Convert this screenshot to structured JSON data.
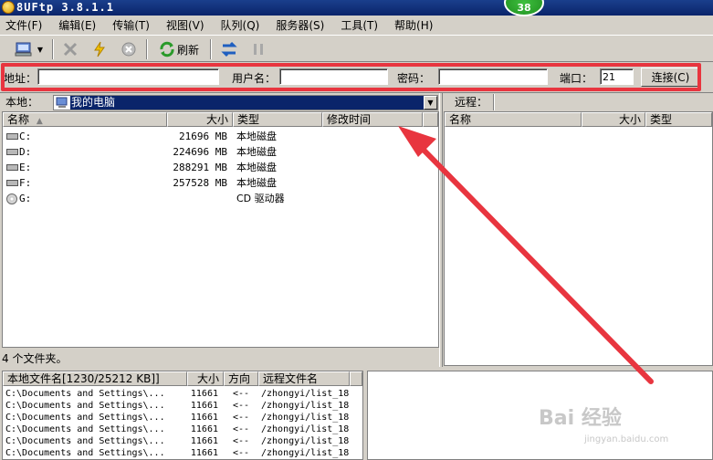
{
  "window": {
    "title": "8UFtp 3.8.1.1",
    "badge": "38"
  },
  "menu": [
    "文件(F)",
    "编辑(E)",
    "传输(T)",
    "视图(V)",
    "队列(Q)",
    "服务器(S)",
    "工具(T)",
    "帮助(H)"
  ],
  "toolbar": {
    "refresh_label": "刷新"
  },
  "connection": {
    "address_label": "地址：",
    "address_value": "",
    "username_label": "用户名：",
    "username_value": "",
    "password_label": "密码：",
    "password_value": "",
    "port_label": "端口：",
    "port_value": "21",
    "connect_label": "连接(C)"
  },
  "local": {
    "label": "本地：",
    "path": "我的电脑",
    "columns": [
      "名称",
      "大小",
      "类型",
      "修改时间"
    ],
    "rows": [
      {
        "name": "C:",
        "size": "21696 MB",
        "type": "本地磁盘"
      },
      {
        "name": "D:",
        "size": "224696 MB",
        "type": "本地磁盘"
      },
      {
        "name": "E:",
        "size": "288291 MB",
        "type": "本地磁盘"
      },
      {
        "name": "F:",
        "size": "257528 MB",
        "type": "本地磁盘"
      },
      {
        "name": "G:",
        "size": "",
        "type": "CD 驱动器"
      }
    ],
    "status": "4 个文件夹。"
  },
  "remote": {
    "label": "远程：",
    "columns": [
      "名称",
      "大小",
      "类型"
    ]
  },
  "queue": {
    "columns": [
      "本地文件名[1230/25212 KB]]",
      "大小",
      "方向",
      "远程文件名"
    ],
    "rows": [
      {
        "local": "C:\\Documents and Settings\\...",
        "size": "11661",
        "dir": "<--",
        "remote": "/zhongyi/list_18"
      },
      {
        "local": "C:\\Documents and Settings\\...",
        "size": "11661",
        "dir": "<--",
        "remote": "/zhongyi/list_18"
      },
      {
        "local": "C:\\Documents and Settings\\...",
        "size": "11661",
        "dir": "<--",
        "remote": "/zhongyi/list_18"
      },
      {
        "local": "C:\\Documents and Settings\\...",
        "size": "11661",
        "dir": "<--",
        "remote": "/zhongyi/list_18"
      },
      {
        "local": "C:\\Documents and Settings\\...",
        "size": "11661",
        "dir": "<--",
        "remote": "/zhongyi/list_18"
      },
      {
        "local": "C:\\Documents and Settings\\...",
        "size": "11661",
        "dir": "<--",
        "remote": "/zhongyi/list_18"
      }
    ]
  },
  "watermark": {
    "main": "Bai 经验",
    "sub": "jingyan.baidu.com"
  },
  "colors": {
    "highlight_red": "#e8353f",
    "title_blue": "#0a246a",
    "window_gray": "#d4d0c8"
  }
}
